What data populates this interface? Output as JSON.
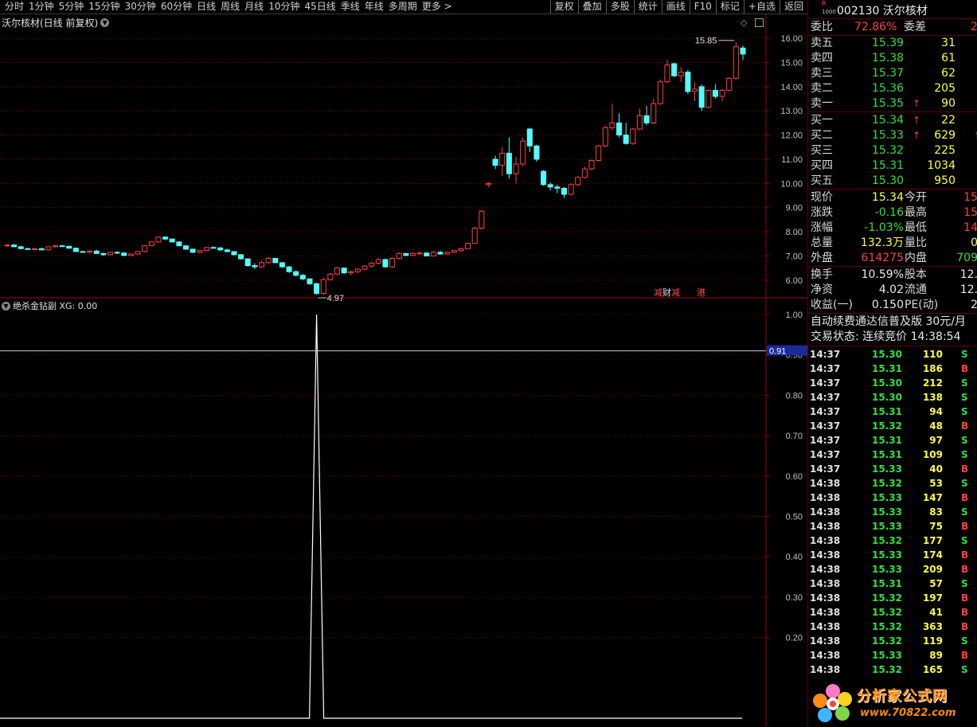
{
  "toolbar": {
    "left": [
      "分时",
      "1分钟",
      "5分钟",
      "15分钟",
      "30分钟",
      "60分钟",
      "日线",
      "周线",
      "月线",
      "10分钟",
      "45日线",
      "季线",
      "年线",
      "多周期",
      "更多 >"
    ],
    "right": [
      "复权",
      "叠加",
      "多股",
      "统计",
      "画线",
      "F10",
      "标记",
      "+自选",
      "返回"
    ]
  },
  "main_chart": {
    "title": "沃尔核材(日线 前复权)",
    "high_label": "15.85",
    "low_label": "4.97",
    "badge_cw_1": "减",
    "badge_cw_2": "财",
    "badge_cw_3": "减",
    "badge_hk": "港"
  },
  "indicator": {
    "title": "绝杀金钻副 XG: 0.00",
    "cursor_value": "0.91"
  },
  "chart_data": [
    {
      "type": "candlestick",
      "title": "沃尔核材(日线 前复权)",
      "ylim": [
        5.4,
        16.4
      ],
      "y_ticks": [
        "16.00",
        "15.00",
        "14.00",
        "13.00",
        "12.00",
        "11.00",
        "10.00",
        "9.00",
        "8.00",
        "7.00",
        "6.00"
      ],
      "ohlc": [
        [
          7.42,
          7.48,
          7.38,
          7.45
        ],
        [
          7.45,
          7.5,
          7.4,
          7.38
        ],
        [
          7.38,
          7.42,
          7.3,
          7.3
        ],
        [
          7.3,
          7.35,
          7.25,
          7.28
        ],
        [
          7.28,
          7.32,
          7.22,
          7.3
        ],
        [
          7.3,
          7.34,
          7.24,
          7.25
        ],
        [
          7.25,
          7.4,
          7.22,
          7.38
        ],
        [
          7.38,
          7.45,
          7.35,
          7.42
        ],
        [
          7.42,
          7.46,
          7.36,
          7.4
        ],
        [
          7.4,
          7.42,
          7.3,
          7.32
        ],
        [
          7.32,
          7.35,
          7.2,
          7.18
        ],
        [
          7.18,
          7.22,
          7.12,
          7.16
        ],
        [
          7.16,
          7.24,
          7.1,
          7.2
        ],
        [
          7.2,
          7.26,
          7.08,
          7.1
        ],
        [
          7.1,
          7.14,
          7.0,
          7.05
        ],
        [
          7.05,
          7.18,
          7.02,
          7.15
        ],
        [
          7.15,
          7.2,
          7.08,
          7.12
        ],
        [
          7.12,
          7.16,
          7.0,
          7.02
        ],
        [
          7.02,
          7.1,
          6.98,
          7.08
        ],
        [
          7.08,
          7.2,
          7.05,
          7.18
        ],
        [
          7.18,
          7.45,
          7.15,
          7.42
        ],
        [
          7.42,
          7.6,
          7.4,
          7.58
        ],
        [
          7.58,
          7.8,
          7.55,
          7.78
        ],
        [
          7.78,
          7.82,
          7.65,
          7.7
        ],
        [
          7.7,
          7.72,
          7.55,
          7.58
        ],
        [
          7.58,
          7.6,
          7.4,
          7.42
        ],
        [
          7.42,
          7.44,
          7.25,
          7.28
        ],
        [
          7.28,
          7.3,
          7.12,
          7.15
        ],
        [
          7.15,
          7.25,
          7.1,
          7.22
        ],
        [
          7.22,
          7.38,
          7.18,
          7.35
        ],
        [
          7.35,
          7.4,
          7.3,
          7.33
        ],
        [
          7.33,
          7.38,
          7.2,
          7.25
        ],
        [
          7.25,
          7.3,
          7.15,
          7.18
        ],
        [
          7.18,
          7.2,
          7.02,
          7.05
        ],
        [
          7.05,
          7.08,
          6.85,
          6.88
        ],
        [
          6.88,
          6.9,
          6.55,
          6.6
        ],
        [
          6.6,
          6.7,
          6.45,
          6.55
        ],
        [
          6.55,
          6.8,
          6.5,
          6.72
        ],
        [
          6.72,
          6.95,
          6.68,
          6.9
        ],
        [
          6.9,
          6.92,
          6.7,
          6.72
        ],
        [
          6.72,
          6.75,
          6.5,
          6.55
        ],
        [
          6.55,
          6.58,
          6.3,
          6.35
        ],
        [
          6.35,
          6.4,
          6.15,
          6.2
        ],
        [
          6.2,
          6.25,
          6.0,
          6.05
        ],
        [
          6.05,
          6.08,
          5.8,
          5.85
        ],
        [
          5.85,
          5.9,
          5.4,
          5.45
        ],
        [
          5.45,
          6.1,
          5.4,
          6.02
        ],
        [
          6.02,
          6.3,
          5.98,
          6.25
        ],
        [
          6.25,
          6.55,
          6.2,
          6.5
        ],
        [
          6.5,
          6.52,
          6.25,
          6.3
        ],
        [
          6.3,
          6.4,
          6.2,
          6.35
        ],
        [
          6.35,
          6.5,
          6.28,
          6.45
        ],
        [
          6.45,
          6.62,
          6.4,
          6.58
        ],
        [
          6.58,
          6.75,
          6.52,
          6.7
        ],
        [
          6.7,
          6.9,
          6.65,
          6.85
        ],
        [
          6.85,
          6.9,
          6.5,
          6.55
        ],
        [
          6.55,
          6.95,
          6.5,
          6.9
        ],
        [
          6.9,
          7.15,
          6.85,
          7.1
        ],
        [
          7.1,
          7.12,
          7.0,
          7.02
        ],
        [
          7.02,
          7.15,
          6.98,
          7.1
        ],
        [
          7.1,
          7.18,
          7.05,
          7.12
        ],
        [
          7.12,
          7.15,
          6.98,
          7.0
        ],
        [
          7.0,
          7.2,
          6.98,
          7.15
        ],
        [
          7.15,
          7.22,
          7.05,
          7.08
        ],
        [
          7.08,
          7.18,
          7.05,
          7.15
        ],
        [
          7.15,
          7.25,
          7.12,
          7.22
        ],
        [
          7.22,
          7.35,
          7.18,
          7.3
        ],
        [
          7.3,
          7.55,
          7.28,
          7.52
        ],
        [
          7.52,
          8.2,
          7.5,
          8.15
        ],
        [
          8.15,
          8.9,
          8.1,
          8.85
        ],
        [
          9.95,
          10.05,
          9.85,
          10.0
        ],
        [
          11.0,
          11.15,
          10.6,
          10.75
        ],
        [
          10.75,
          11.5,
          10.3,
          11.25
        ],
        [
          11.25,
          11.9,
          10.2,
          10.4
        ],
        [
          10.4,
          11.1,
          10.0,
          10.8
        ],
        [
          10.8,
          11.9,
          10.7,
          11.75
        ],
        [
          12.25,
          12.3,
          11.3,
          11.55
        ],
        [
          11.55,
          11.6,
          10.9,
          11.0
        ],
        [
          10.5,
          10.55,
          9.9,
          9.95
        ],
        [
          9.95,
          10.05,
          9.7,
          9.85
        ],
        [
          9.85,
          9.95,
          9.6,
          9.8
        ],
        [
          9.8,
          9.85,
          9.4,
          9.55
        ],
        [
          9.55,
          10.0,
          9.5,
          9.95
        ],
        [
          9.95,
          10.3,
          9.9,
          10.25
        ],
        [
          10.25,
          10.7,
          10.2,
          10.6
        ],
        [
          10.6,
          11.0,
          10.55,
          10.95
        ],
        [
          10.95,
          11.6,
          10.9,
          11.55
        ],
        [
          11.55,
          12.4,
          11.5,
          12.3
        ],
        [
          12.3,
          13.3,
          12.2,
          12.5
        ],
        [
          12.5,
          12.9,
          11.9,
          12.0
        ],
        [
          12.0,
          12.5,
          11.6,
          11.65
        ],
        [
          11.65,
          12.3,
          11.6,
          12.25
        ],
        [
          12.25,
          13.1,
          12.2,
          12.8
        ],
        [
          12.8,
          13.2,
          12.4,
          12.5
        ],
        [
          12.5,
          13.5,
          12.45,
          13.3
        ],
        [
          13.3,
          14.3,
          13.25,
          14.2
        ],
        [
          14.2,
          15.1,
          14.15,
          14.9
        ],
        [
          14.95,
          15.0,
          14.4,
          14.45
        ],
        [
          14.45,
          14.8,
          14.2,
          14.6
        ],
        [
          14.6,
          14.7,
          13.7,
          13.8
        ],
        [
          13.8,
          14.2,
          13.4,
          13.9
        ],
        [
          14.0,
          14.1,
          13.0,
          13.15
        ],
        [
          13.15,
          13.9,
          13.1,
          13.85
        ],
        [
          13.85,
          14.1,
          13.5,
          13.6
        ],
        [
          13.6,
          13.9,
          13.4,
          13.85
        ],
        [
          13.85,
          14.4,
          13.8,
          14.35
        ],
        [
          14.35,
          15.85,
          14.3,
          15.65
        ],
        [
          15.6,
          15.7,
          15.1,
          15.35
        ]
      ]
    },
    {
      "type": "line",
      "title": "绝杀金钻副 XG: 0.00",
      "ylim": [
        0,
        1.0
      ],
      "y_ticks": [
        "1.00",
        "0.90",
        "0.80",
        "0.70",
        "0.60",
        "0.50",
        "0.40",
        "0.30",
        "0.20"
      ],
      "series": [
        {
          "values": [
            0,
            1.0,
            0
          ]
        }
      ]
    }
  ],
  "panel": {
    "code_title": "002130 沃尔核材",
    "weibi": {
      "label": "委比",
      "value": "72.86%",
      "label2": "委差",
      "value2": "2"
    },
    "asks": [
      {
        "label": "卖五",
        "price": "15.39",
        "vol": "31"
      },
      {
        "label": "卖四",
        "price": "15.38",
        "vol": "61"
      },
      {
        "label": "卖三",
        "price": "15.37",
        "vol": "62"
      },
      {
        "label": "卖二",
        "price": "15.36",
        "vol": "205"
      },
      {
        "label": "卖一",
        "price": "15.35",
        "vol": "90",
        "arrow": "↑"
      }
    ],
    "bids": [
      {
        "label": "买一",
        "price": "15.34",
        "vol": "22",
        "arrow": "↑"
      },
      {
        "label": "买二",
        "price": "15.33",
        "vol": "629",
        "arrow": "↑"
      },
      {
        "label": "买三",
        "price": "15.32",
        "vol": "225"
      },
      {
        "label": "买四",
        "price": "15.31",
        "vol": "1034"
      },
      {
        "label": "买五",
        "price": "15.30",
        "vol": "950"
      }
    ],
    "quote": [
      {
        "l1": "现价",
        "v1": "15.34",
        "l2": "今开",
        "v2": "15"
      },
      {
        "l1": "涨跌",
        "v1": "-0.16",
        "l2": "最高",
        "v2": "15"
      },
      {
        "l1": "涨幅",
        "v1": "-1.03%",
        "l2": "最低",
        "v2": "14"
      },
      {
        "l1": "总量",
        "v1": "132.3万",
        "l2": "量比",
        "v2": "0"
      },
      {
        "l1": "外盘",
        "v1": "614275",
        "l2": "内盘",
        "v2": "709"
      }
    ],
    "fin": [
      {
        "l1": "换手",
        "v1": "10.59%",
        "l2": "股本",
        "v2": "12."
      },
      {
        "l1": "净资",
        "v1": "4.02",
        "l2": "流通",
        "v2": "12."
      },
      {
        "l1": "收益(一)",
        "v1": "0.150",
        "l2": "PE(动)",
        "v2": "2"
      }
    ],
    "promo": "自动续费通达信普及版  30元/月",
    "status": "交易状态: 连续竞价 14:38:54",
    "ticks": [
      {
        "t": "14:37",
        "p": "15.30",
        "v": "110",
        "bs": "S"
      },
      {
        "t": "14:37",
        "p": "15.31",
        "v": "186",
        "bs": "B"
      },
      {
        "t": "14:37",
        "p": "15.30",
        "v": "212",
        "bs": "S"
      },
      {
        "t": "14:37",
        "p": "15.30",
        "v": "138",
        "bs": "S"
      },
      {
        "t": "14:37",
        "p": "15.31",
        "v": "94",
        "bs": "S"
      },
      {
        "t": "14:37",
        "p": "15.32",
        "v": "48",
        "bs": "B"
      },
      {
        "t": "14:37",
        "p": "15.31",
        "v": "97",
        "bs": "S"
      },
      {
        "t": "14:37",
        "p": "15.31",
        "v": "109",
        "bs": "S"
      },
      {
        "t": "14:37",
        "p": "15.33",
        "v": "40",
        "bs": "B"
      },
      {
        "t": "14:38",
        "p": "15.32",
        "v": "53",
        "bs": "S"
      },
      {
        "t": "14:38",
        "p": "15.33",
        "v": "147",
        "bs": "B"
      },
      {
        "t": "14:38",
        "p": "15.33",
        "v": "83",
        "bs": "S"
      },
      {
        "t": "14:38",
        "p": "15.33",
        "v": "75",
        "bs": "B"
      },
      {
        "t": "14:38",
        "p": "15.32",
        "v": "177",
        "bs": "S"
      },
      {
        "t": "14:38",
        "p": "15.33",
        "v": "174",
        "bs": "B"
      },
      {
        "t": "14:38",
        "p": "15.33",
        "v": "209",
        "bs": "B"
      },
      {
        "t": "14:38",
        "p": "15.31",
        "v": "57",
        "bs": "S"
      },
      {
        "t": "14:38",
        "p": "15.32",
        "v": "197",
        "bs": "B"
      },
      {
        "t": "14:38",
        "p": "15.32",
        "v": "41",
        "bs": "B"
      },
      {
        "t": "14:38",
        "p": "15.32",
        "v": "363",
        "bs": "B"
      },
      {
        "t": "14:38",
        "p": "15.32",
        "v": "119",
        "bs": "S"
      },
      {
        "t": "14:38",
        "p": "15.33",
        "v": "89",
        "bs": "B"
      },
      {
        "t": "14:38",
        "p": "15.32",
        "v": "165",
        "bs": "S"
      }
    ]
  },
  "watermark": {
    "title": "分析家公式网",
    "url": "www.70822.com"
  },
  "colors": {
    "up": "#ff4040",
    "down": "#54fcfc",
    "flat": "#ffffff",
    "grid": "#8b0000",
    "axis_text": "#c0c0c0"
  }
}
